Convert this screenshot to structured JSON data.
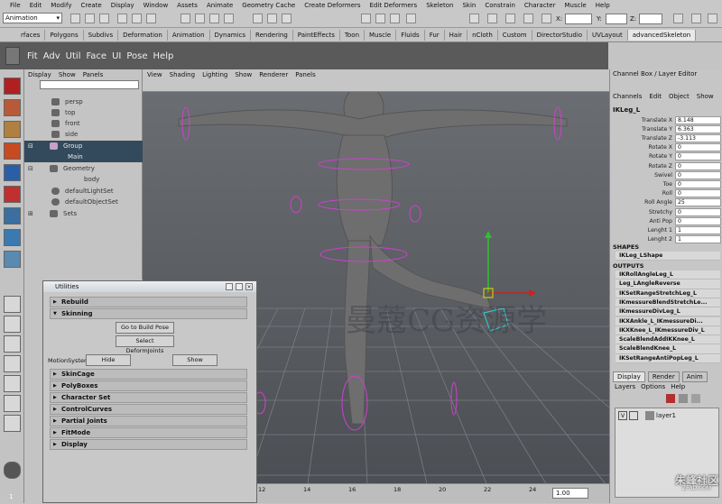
{
  "menubar": [
    "File",
    "Edit",
    "Modify",
    "Create",
    "Display",
    "Window",
    "Assets",
    "Animate",
    "Geometry Cache",
    "Create Deformers",
    "Edit Deformers",
    "Skeleton",
    "Skin",
    "Constrain",
    "Character",
    "Muscle",
    "Help"
  ],
  "status": {
    "mode": "Animation",
    "x_label": "X:",
    "y_label": "Y:",
    "z_label": "Z:"
  },
  "shelf_tabs": [
    "rfaces",
    "Polygons",
    "Subdivs",
    "Deformation",
    "Animation",
    "Dynamics",
    "Rendering",
    "PaintEffects",
    "Toon",
    "Muscle",
    "Fluids",
    "Fur",
    "Hair",
    "nCloth",
    "Custom",
    "DirectorStudio",
    "UVLayout",
    "advancedSkeleton"
  ],
  "shelf_active": "advancedSkeleton",
  "shelf_buttons": [
    "Fit",
    "Adv",
    "Util",
    "Face",
    "UI",
    "Pose",
    "Help"
  ],
  "outliner": {
    "menu": [
      "Display",
      "Show",
      "Panels"
    ],
    "items": [
      "persp",
      "top",
      "front",
      "side",
      "Group",
      "Main",
      "Geometry",
      "body",
      "defaultLightSet",
      "defaultObjectSet",
      "Sets"
    ]
  },
  "viewport": {
    "menu": [
      "View",
      "Shading",
      "Lighting",
      "Show",
      "Renderer",
      "Panels"
    ]
  },
  "utilities": {
    "title": "Utilities",
    "frames_top": [
      "Rebuild",
      "Skinning"
    ],
    "go_build_pose": "Go to Build Pose",
    "select_deform": "Select DeformJoints",
    "motion_label": "MotionSystem:",
    "hide": "Hide",
    "show": "Show",
    "frames_bottom": [
      "SkinCage",
      "PolyBoxes",
      "Character Set",
      "ControlCurves",
      "Partial Joints",
      "FitMode",
      "Display"
    ]
  },
  "channel_box": {
    "title": "Channel Box / Layer Editor",
    "menu": [
      "Channels",
      "Edit",
      "Object",
      "Show"
    ],
    "object": "IKLeg_L",
    "channels": [
      {
        "name": "Translate X",
        "value": "8.148"
      },
      {
        "name": "Translate Y",
        "value": "6.363"
      },
      {
        "name": "Translate Z",
        "value": "-3.113"
      },
      {
        "name": "Rotate X",
        "value": "0"
      },
      {
        "name": "Rotate Y",
        "value": "0"
      },
      {
        "name": "Rotate Z",
        "value": "0"
      },
      {
        "name": "Swivel",
        "value": "0"
      },
      {
        "name": "Toe",
        "value": "0"
      },
      {
        "name": "Roll",
        "value": "0"
      },
      {
        "name": "Roll Angle",
        "value": "25"
      },
      {
        "name": "Stretchy",
        "value": "0"
      },
      {
        "name": "Anti Pop",
        "value": "0"
      },
      {
        "name": "Lenght 1",
        "value": "1"
      },
      {
        "name": "Lenght 2",
        "value": "1"
      }
    ],
    "shapes_label": "SHAPES",
    "shape": "IKLeg_LShape",
    "outputs_label": "OUTPUTS",
    "outputs": [
      "IKRollAngleLeg_L",
      "Leg_LAngleReverse",
      "IKSetRangeStretchLeg_L",
      "IKmessureBlendStretchLe...",
      "IKmessureDivLeg_L",
      "IKXAnkle_L_IKmessureDi...",
      "IKXKnee_L_IKmessureDiv_L",
      "ScaleBlendAddIKKnee_L",
      "ScaleBlendKnee_L",
      "IKSetRangeAntiPopLeg_L"
    ]
  },
  "layers": {
    "tabs": [
      "Display",
      "Render",
      "Anim"
    ],
    "menu": [
      "Layers",
      "Options",
      "Help"
    ],
    "layer_name": "layer1",
    "vis": "V"
  },
  "timeline": {
    "ticks": [
      "12",
      "14",
      "16",
      "18",
      "20",
      "22",
      "24"
    ],
    "current": "1.00"
  },
  "watermark": {
    "text": "曼蔻CG资源学",
    "logo": "朱峰社区",
    "logo_sub": "ZF3D.COM"
  },
  "toolbox_bottom": "1"
}
